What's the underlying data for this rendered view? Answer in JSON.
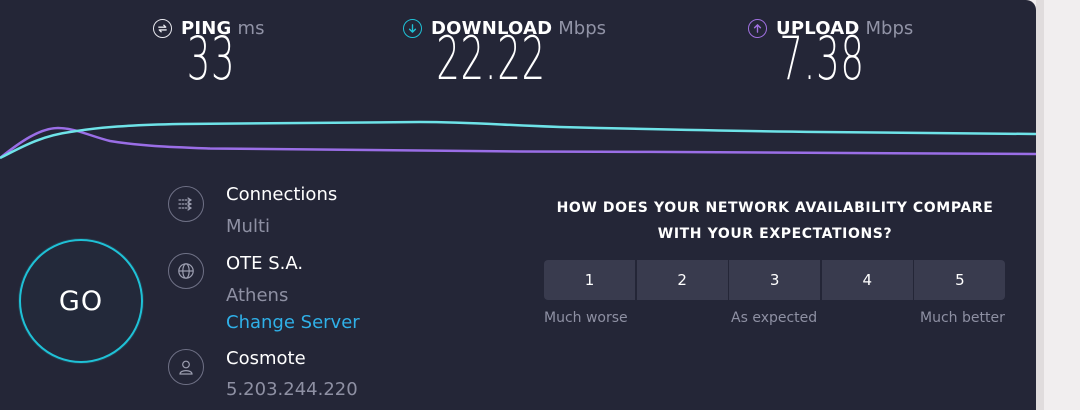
{
  "metrics": {
    "ping": {
      "label": "PING",
      "unit": "ms",
      "value": "33",
      "icon": "ping-icon"
    },
    "download": {
      "label": "DOWNLOAD",
      "unit": "Mbps",
      "value": "22.22",
      "icon": "download-arrow-icon",
      "color": "#1fc1d6"
    },
    "upload": {
      "label": "UPLOAD",
      "unit": "Mbps",
      "value": "7.38",
      "icon": "upload-arrow-icon",
      "color": "#a070e0"
    }
  },
  "graph": {
    "download_color": "#6ee3e8",
    "upload_color": "#9a6ee6"
  },
  "go_button": {
    "label": "GO",
    "ring_color": "#1fc1d6"
  },
  "info": {
    "connections": {
      "title": "Connections",
      "value": "Multi",
      "icon": "connections-icon"
    },
    "server": {
      "title": "OTE S.A.",
      "location": "Athens",
      "change_link": "Change Server",
      "icon": "globe-icon"
    },
    "provider": {
      "title": "Cosmote",
      "ip": "5.203.244.220",
      "icon": "user-icon"
    }
  },
  "survey": {
    "question_line1": "HOW DOES YOUR NETWORK AVAILABILITY COMPARE",
    "question_line2": "WITH YOUR EXPECTATIONS?",
    "options": [
      "1",
      "2",
      "3",
      "4",
      "5"
    ],
    "label_low": "Much worse",
    "label_mid": "As expected",
    "label_high": "Much better"
  }
}
